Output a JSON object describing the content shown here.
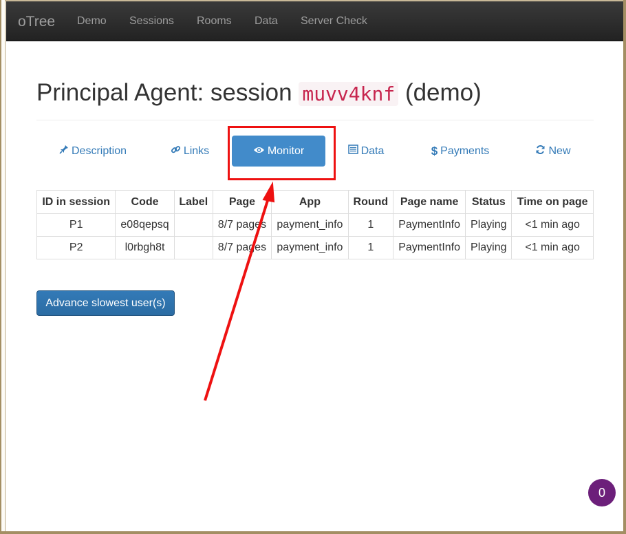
{
  "navbar": {
    "brand": "oTree",
    "links": [
      "Demo",
      "Sessions",
      "Rooms",
      "Data",
      "Server Check"
    ]
  },
  "header": {
    "title_prefix": "Principal Agent: session",
    "session_code": "muvv4knf",
    "title_suffix": "(demo)"
  },
  "tabs": [
    {
      "label": "Description",
      "icon": "pushpin-icon"
    },
    {
      "label": "Links",
      "icon": "link-icon"
    },
    {
      "label": "Monitor",
      "icon": "eye-icon",
      "active": true
    },
    {
      "label": "Data",
      "icon": "list-icon"
    },
    {
      "label": "Payments",
      "icon": "dollar-icon"
    },
    {
      "label": "New",
      "icon": "refresh-icon"
    }
  ],
  "table": {
    "columns": [
      "ID in session",
      "Code",
      "Label",
      "Page",
      "App",
      "Round",
      "Page name",
      "Status",
      "Time on page"
    ],
    "rows": [
      [
        "P1",
        "e08qepsq",
        "",
        "8/7 pages",
        "payment_info",
        "1",
        "PaymentInfo",
        "Playing",
        "<1 min ago"
      ],
      [
        "P2",
        "l0rbgh8t",
        "",
        "8/7 pages",
        "payment_info",
        "1",
        "PaymentInfo",
        "Playing",
        "<1 min ago"
      ]
    ]
  },
  "actions": {
    "advance_label": "Advance slowest user(s)"
  },
  "chat": {
    "count": "0"
  },
  "colors": {
    "accent": "#428bca",
    "link": "#337ab7",
    "annotation": "#ee1111",
    "badge": "#6c1f7a"
  }
}
